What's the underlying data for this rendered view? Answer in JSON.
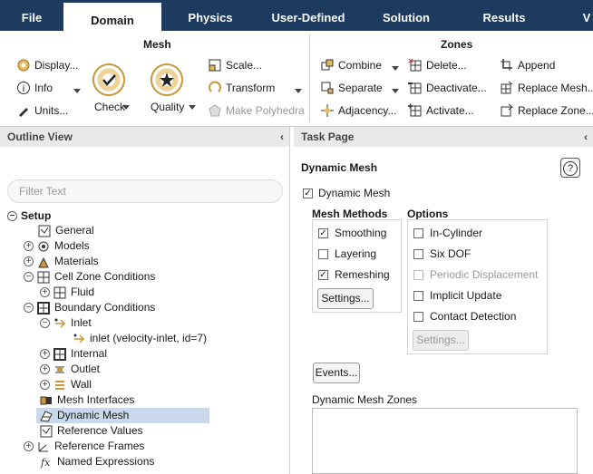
{
  "tabs": [
    "File",
    "Domain",
    "Physics",
    "User-Defined",
    "Solution",
    "Results",
    "V"
  ],
  "ribbon": {
    "mesh": {
      "title": "Mesh",
      "display": "Display...",
      "info": "Info",
      "units": "Units...",
      "check": "Check",
      "quality": "Quality",
      "scale": "Scale...",
      "transform": "Transform",
      "polyhedra": "Make Polyhedra"
    },
    "zones": {
      "title": "Zones",
      "combine": "Combine",
      "separate": "Separate",
      "adjacency": "Adjacency...",
      "delete": "Delete...",
      "deactivate": "Deactivate...",
      "activate": "Activate...",
      "append": "Append",
      "replace_mesh": "Replace Mesh...",
      "replace_zone": "Replace Zone..."
    }
  },
  "outline": {
    "title": "Outline View",
    "filter_placeholder": "Filter Text",
    "items": [
      "Setup",
      "General",
      "Models",
      "Materials",
      "Cell Zone Conditions",
      "Fluid",
      "Boundary Conditions",
      "Inlet",
      "inlet (velocity-inlet, id=7)",
      "Internal",
      "Outlet",
      "Wall",
      "Mesh Interfaces",
      "Dynamic Mesh",
      "Reference Values",
      "Reference Frames",
      "Named Expressions"
    ]
  },
  "task": {
    "title": "Task Page",
    "heading": "Dynamic Mesh",
    "help": "?",
    "dynamic_mesh": "Dynamic Mesh",
    "methods_title": "Mesh Methods",
    "methods": [
      "Smoothing",
      "Layering",
      "Remeshing"
    ],
    "methods_checked": [
      true,
      false,
      true
    ],
    "settings": "Settings...",
    "options_title": "Options",
    "options": [
      "In-Cylinder",
      "Six DOF",
      "Periodic Displacement",
      "Implicit Update",
      "Contact Detection"
    ],
    "options_settings": "Settings...",
    "events": "Events...",
    "zones_title": "Dynamic Mesh Zones"
  }
}
